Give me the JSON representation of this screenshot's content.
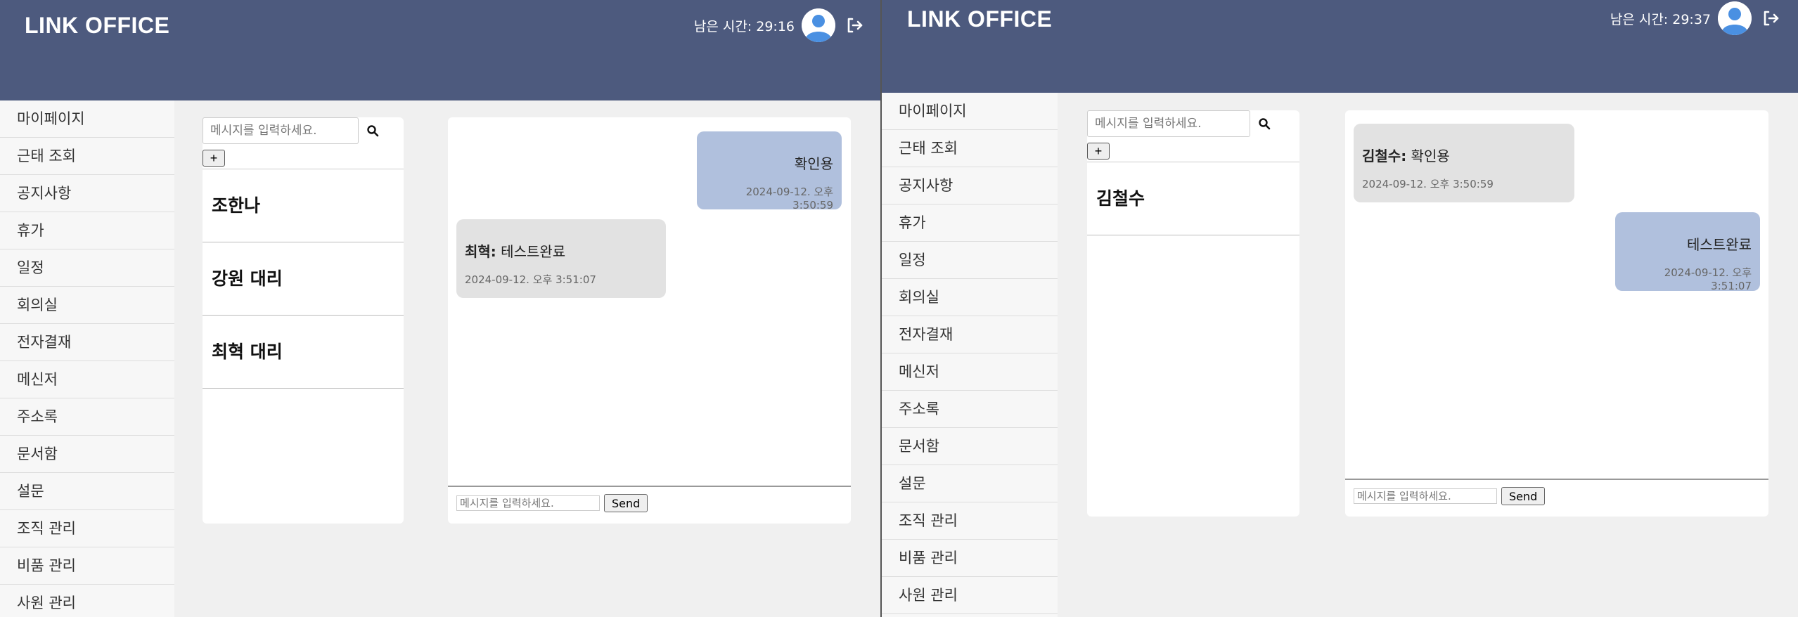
{
  "left": {
    "header": {
      "logo": "LINK OFFICE",
      "timer": "남은 시간: 29:16"
    },
    "menu": [
      "마이페이지",
      "근태 조회",
      "공지사항",
      "휴가",
      "일정",
      "회의실",
      "전자결재",
      "메신저",
      "주소록",
      "문서함",
      "설문",
      "조직 관리",
      "비품 관리",
      "사원 관리"
    ],
    "search": {
      "placeholder": "메시지를 입력하세요.",
      "add_label": "+"
    },
    "contacts": [
      "조한나",
      "강원 대리",
      "최혁 대리"
    ],
    "messages": [
      {
        "mine": true,
        "text": "확인용",
        "time": "2024-09-12. 오후 3:50:59"
      },
      {
        "mine": false,
        "sender": "최혁:",
        "text": " 테스트완료",
        "time": "2024-09-12. 오후 3:51:07"
      }
    ],
    "chat": {
      "placeholder": "메시지를 입력하세요.",
      "send_label": "Send"
    }
  },
  "right": {
    "header": {
      "logo": "LINK OFFICE",
      "timer": "남은 시간: 29:37"
    },
    "menu": [
      "마이페이지",
      "근태 조회",
      "공지사항",
      "휴가",
      "일정",
      "회의실",
      "전자결재",
      "메신저",
      "주소록",
      "문서함",
      "설문",
      "조직 관리",
      "비품 관리",
      "사원 관리"
    ],
    "search": {
      "placeholder": "메시지를 입력하세요.",
      "add_label": "+"
    },
    "contacts": [
      "김철수"
    ],
    "messages": [
      {
        "mine": false,
        "sender": "김철수:",
        "text": " 확인용",
        "time": "2024-09-12. 오후 3:50:59"
      },
      {
        "mine": true,
        "text": "테스트완료",
        "time": "2024-09-12. 오후 3:51:07"
      }
    ],
    "chat": {
      "placeholder": "메시지를 입력하세요.",
      "send_label": "Send"
    }
  },
  "colors": {
    "header": "#4d5a7e",
    "my_bubble": "#b0c0dd",
    "their_bubble": "#e2e2e2",
    "avatar": "#4a90e2"
  },
  "icons": {
    "search": "search-icon",
    "avatar": "user-avatar-icon",
    "logout": "logout-icon",
    "add": "plus-icon"
  }
}
